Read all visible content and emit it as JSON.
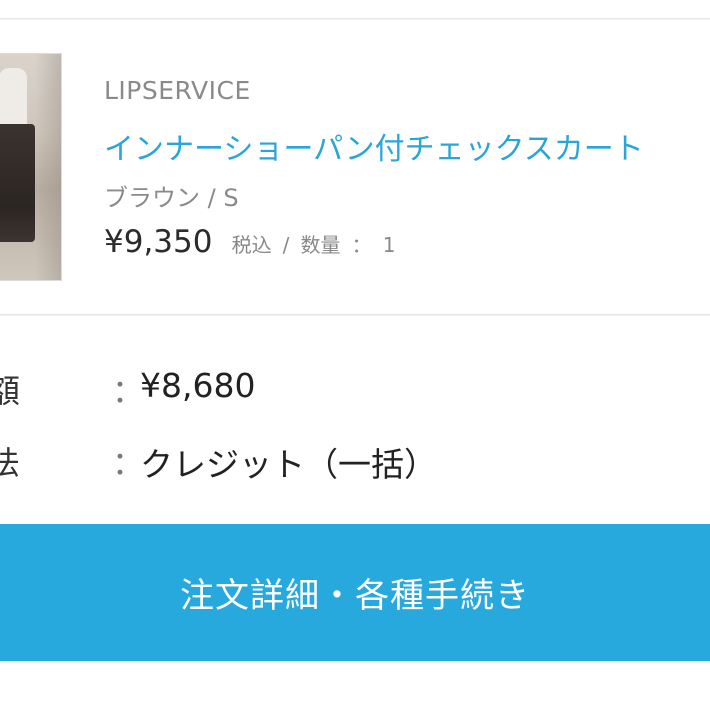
{
  "order_item": {
    "brand": "LIPSERVICE",
    "product_name": "インナーショーパン付チェックスカート",
    "variant": "ブラウン / S",
    "price": "¥9,350",
    "tax_label": "税込",
    "separator": "/",
    "quantity_label": "数量",
    "quantity_colon": "：",
    "quantity": "1"
  },
  "summary": {
    "total": {
      "label": "額",
      "colon": "：",
      "value": "¥8,680"
    },
    "payment": {
      "label": "法",
      "colon": "：",
      "value": "クレジット（一括）"
    }
  },
  "actions": {
    "order_details_button": "注文詳細・各種手続き",
    "button_color": "#27a9de"
  },
  "colors": {
    "product_link": "#2aa5d8",
    "muted_text": "#8a8a8a"
  }
}
